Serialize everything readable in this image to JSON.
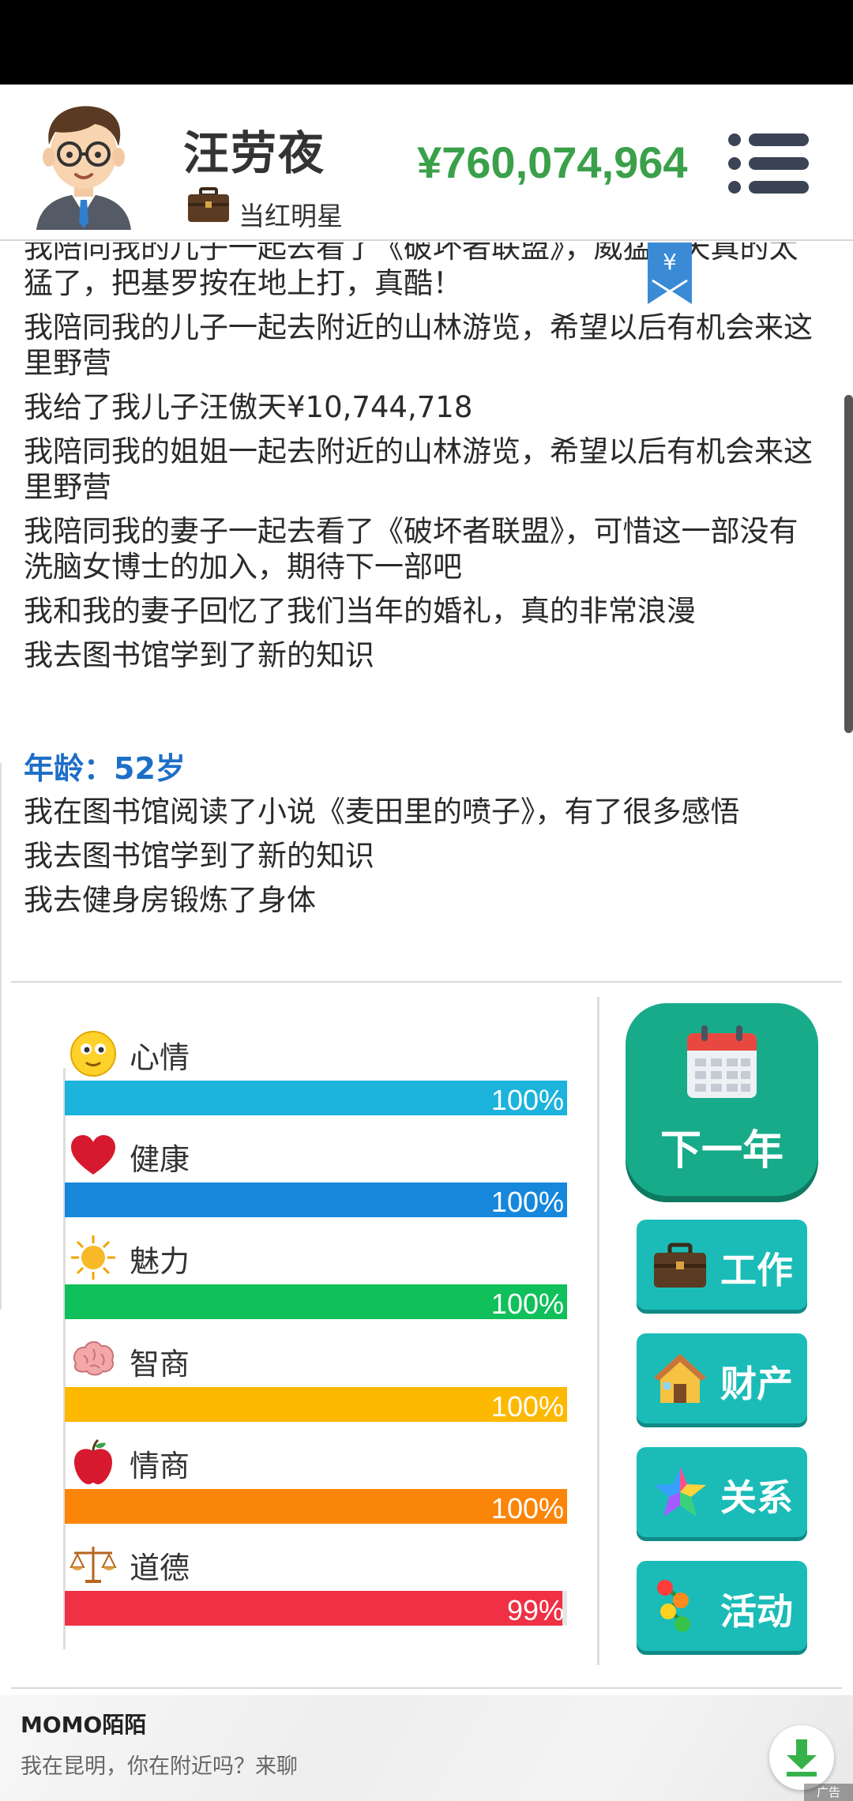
{
  "header": {
    "name": "汪劳夜",
    "job": "当红明星",
    "money": "¥760,074,964"
  },
  "log": {
    "lines_before": [
      "我陪同我的儿子一起去看了《破坏者联盟》，威猛霸天真的太猛了，把基罗按在地上打，真酷！",
      "我陪同我的儿子一起去附近的山林游览，希望以后有机会来这里野营",
      "我给了我儿子汪傲天¥10,744,718",
      "我陪同我的姐姐一起去附近的山林游览，希望以后有机会来这里野营",
      "我陪同我的妻子一起去看了《破坏者联盟》，可惜这一部没有洗脑女博士的加入，期待下一部吧",
      "我和我的妻子回忆了我们当年的婚礼，真的非常浪漫",
      "我去图书馆学到了新的知识"
    ],
    "age_label": "年龄：52岁",
    "lines_after": [
      "我在图书馆阅读了小说《麦田里的喷子》，有了很多感悟",
      "我去图书馆学到了新的知识",
      "我去健身房锻炼了身体"
    ],
    "badge_symbol": "¥"
  },
  "stats": [
    {
      "label": "心情",
      "value": 100,
      "text": "100%",
      "color": "#1cb3dc",
      "icon": "smiley-icon"
    },
    {
      "label": "健康",
      "value": 100,
      "text": "100%",
      "color": "#1787dc",
      "icon": "heart-icon"
    },
    {
      "label": "魅力",
      "value": 100,
      "text": "100%",
      "color": "#10c05a",
      "icon": "sun-icon"
    },
    {
      "label": "智商",
      "value": 100,
      "text": "100%",
      "color": "#fdb800",
      "icon": "brain-icon"
    },
    {
      "label": "情商",
      "value": 100,
      "text": "100%",
      "color": "#fb8509",
      "icon": "apple-icon"
    },
    {
      "label": "道德",
      "value": 99,
      "text": "99%",
      "color": "#ef3045",
      "icon": "scale-icon"
    }
  ],
  "buttons": {
    "next_year": "下一年",
    "work": "工作",
    "property": "财产",
    "relations": "关系",
    "activity": "活动"
  },
  "ad": {
    "title": "MOMO陌陌",
    "subtitle": "我在昆明，你在附近吗？来聊",
    "tag": "广告"
  }
}
